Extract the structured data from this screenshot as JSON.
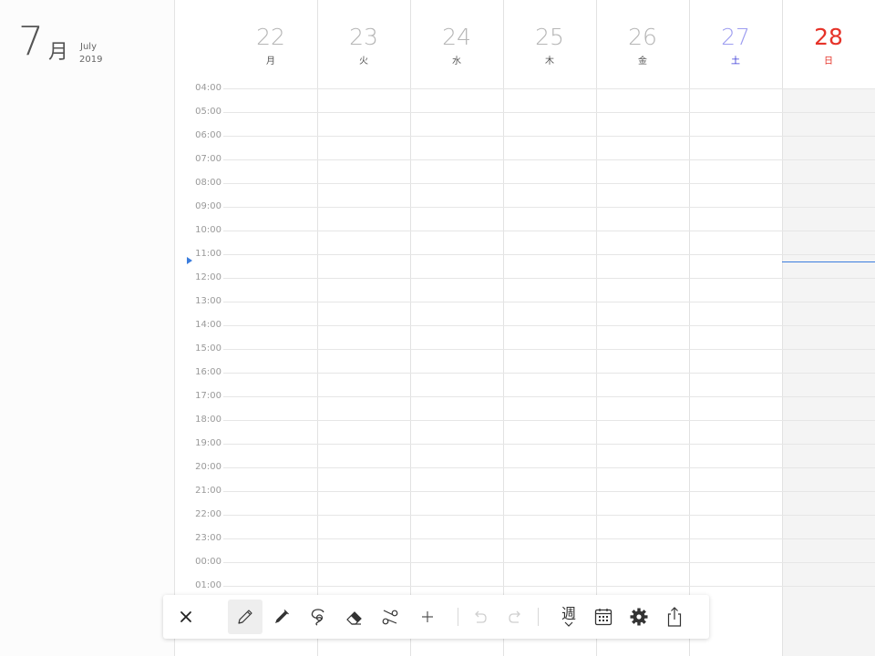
{
  "header": {
    "month_number": "7",
    "month_kanji": "月",
    "month_name": "July",
    "year": "2019"
  },
  "days": [
    {
      "num": "22",
      "weekday": "月",
      "type": "weekday"
    },
    {
      "num": "23",
      "weekday": "火",
      "type": "weekday"
    },
    {
      "num": "24",
      "weekday": "水",
      "type": "weekday"
    },
    {
      "num": "25",
      "weekday": "木",
      "type": "weekday"
    },
    {
      "num": "26",
      "weekday": "金",
      "type": "weekday"
    },
    {
      "num": "27",
      "weekday": "土",
      "type": "saturday"
    },
    {
      "num": "28",
      "weekday": "日",
      "type": "sunday",
      "today": true
    }
  ],
  "hours": [
    "04:00",
    "05:00",
    "06:00",
    "07:00",
    "08:00",
    "09:00",
    "10:00",
    "11:00",
    "12:00",
    "13:00",
    "14:00",
    "15:00",
    "16:00",
    "17:00",
    "18:00",
    "19:00",
    "20:00",
    "21:00",
    "22:00",
    "23:00",
    "00:00",
    "01:00"
  ],
  "colors": {
    "today": "#e63329",
    "saturday": "#3a3ad8",
    "current_time": "#3b7ddd"
  },
  "toolbar": {
    "close_icon": "close-icon",
    "pencil_icon": "pencil-icon",
    "pen_icon": "pen-icon",
    "lasso_icon": "lasso-icon",
    "eraser_icon": "eraser-icon",
    "scissors_icon": "scissors-icon",
    "add_icon": "plus-icon",
    "undo_icon": "undo-icon",
    "redo_icon": "redo-icon",
    "view_label": "週",
    "calendar_icon": "calendar-icon",
    "settings_icon": "gear-icon",
    "share_icon": "share-icon"
  }
}
